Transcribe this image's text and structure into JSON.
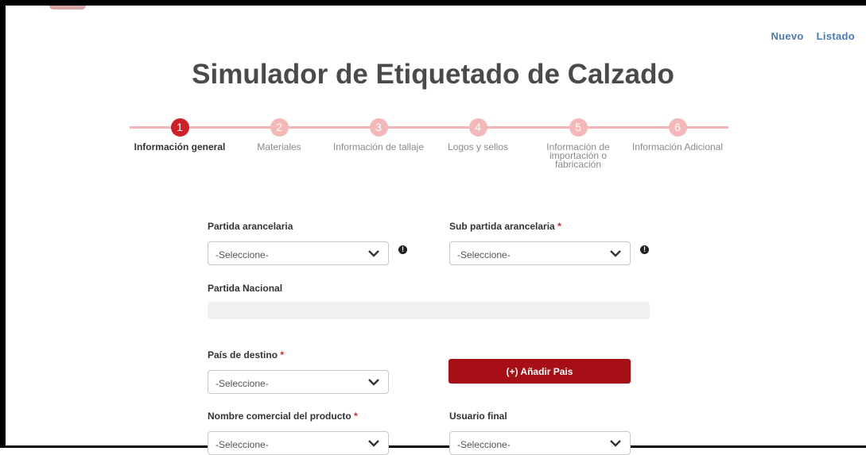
{
  "header": {
    "nav": {
      "nuevo": "Nuevo",
      "listado": "Listado"
    }
  },
  "page_title": "Simulador de Etiquetado de Calzado",
  "stepper": {
    "steps": [
      {
        "number": "1",
        "label": "Información general",
        "active": true
      },
      {
        "number": "2",
        "label": "Materiales",
        "active": false
      },
      {
        "number": "3",
        "label": "Información de tallaje",
        "active": false
      },
      {
        "number": "4",
        "label": "Logos y sellos",
        "active": false
      },
      {
        "number": "5",
        "label": "Información de importación o fabricación",
        "active": false
      },
      {
        "number": "6",
        "label": "Información Adicional",
        "active": false
      }
    ]
  },
  "form": {
    "partida_arancelaria": {
      "label": "Partida arancelaria",
      "value": "-Seleccione-",
      "info_icon": "info-icon"
    },
    "sub_partida_arancelaria": {
      "label": "Sub partida arancelaria",
      "required_mark": "*",
      "value": "-Seleccione-",
      "info_icon": "info-icon"
    },
    "partida_nacional": {
      "label": "Partida Nacional",
      "value": ""
    },
    "pais_destino": {
      "label": "País de destino",
      "required_mark": "*",
      "value": "-Seleccione-"
    },
    "add_country_button": "(+) Añadir Pais",
    "nombre_comercial": {
      "label": "Nombre comercial del producto",
      "required_mark": "*",
      "value": "-Seleccione-"
    },
    "usuario_final": {
      "label": "Usuario final",
      "value": "-Seleccione-"
    }
  },
  "colors": {
    "active_step": "#cf2027",
    "inactive_step": "#f5b8b8",
    "button": "#a50f15",
    "link": "#4a7ab8"
  }
}
